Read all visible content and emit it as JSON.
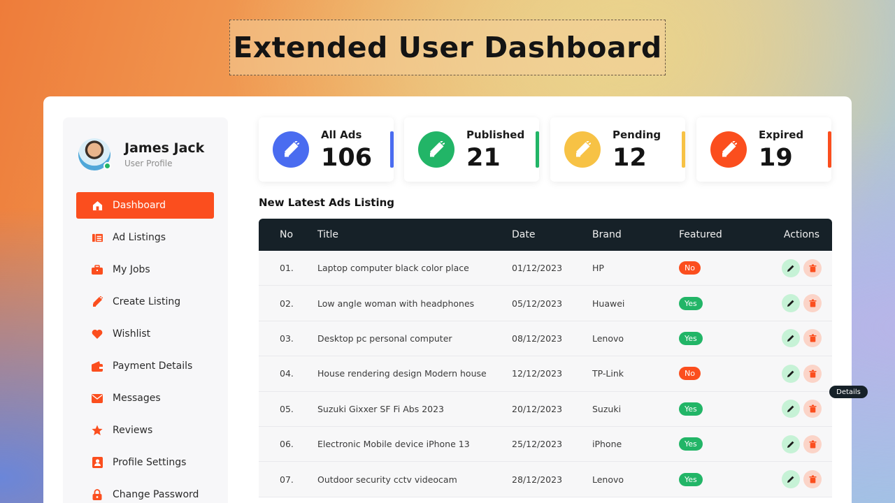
{
  "banner": {
    "title": "Extended User Dashboard"
  },
  "profile": {
    "name": "James Jack",
    "role": "User Profile",
    "status": "online"
  },
  "menu": [
    {
      "label": "Dashboard",
      "icon": "home-icon",
      "active": true
    },
    {
      "label": "Ad Listings",
      "icon": "list-icon",
      "active": false
    },
    {
      "label": "My Jobs",
      "icon": "briefcase-icon",
      "active": false
    },
    {
      "label": "Create Listing",
      "icon": "megaphone-icon",
      "active": false
    },
    {
      "label": "Wishlist",
      "icon": "heart-icon",
      "active": false
    },
    {
      "label": "Payment Details",
      "icon": "wallet-icon",
      "active": false
    },
    {
      "label": "Messages",
      "icon": "envelope-icon",
      "active": false
    },
    {
      "label": "Reviews",
      "icon": "star-icon",
      "active": false
    },
    {
      "label": "Profile Settings",
      "icon": "user-settings-icon",
      "active": false
    },
    {
      "label": "Change Password",
      "icon": "lock-icon",
      "active": false
    }
  ],
  "stats": [
    {
      "label": "All Ads",
      "value": "106",
      "color": "#4a6cf0"
    },
    {
      "label": "Published",
      "value": "21",
      "color": "#22b567"
    },
    {
      "label": "Pending",
      "value": "12",
      "color": "#f7c245"
    },
    {
      "label": "Expired",
      "value": "19",
      "color": "#fb4e1e"
    }
  ],
  "listing": {
    "title": "New Latest Ads Listing",
    "columns": [
      "No",
      "Title",
      "Date",
      "Brand",
      "Featured",
      "Actions"
    ],
    "rows": [
      {
        "no": "01.",
        "title": "Laptop computer black color place",
        "date": "01/12/2023",
        "brand": "HP",
        "featured": "No"
      },
      {
        "no": "02.",
        "title": "Low angle woman with headphones",
        "date": "05/12/2023",
        "brand": "Huawei",
        "featured": "Yes"
      },
      {
        "no": "03.",
        "title": "Desktop pc personal computer",
        "date": "08/12/2023",
        "brand": "Lenovo",
        "featured": "Yes"
      },
      {
        "no": "04.",
        "title": "House rendering design Modern house",
        "date": "12/12/2023",
        "brand": "TP-Link",
        "featured": "No"
      },
      {
        "no": "05.",
        "title": "Suzuki Gixxer SF Fi Abs 2023",
        "date": "20/12/2023",
        "brand": "Suzuki",
        "featured": "Yes"
      },
      {
        "no": "06.",
        "title": "Electronic Mobile device iPhone 13",
        "date": "25/12/2023",
        "brand": "iPhone",
        "featured": "Yes"
      },
      {
        "no": "07.",
        "title": "Outdoor security cctv videocam",
        "date": "28/12/2023",
        "brand": "Lenovo",
        "featured": "Yes"
      }
    ]
  },
  "tooltip": {
    "text": "Details"
  },
  "colors": {
    "accent": "#fb4e1e",
    "header": "#162128",
    "yes": "#22b567",
    "no": "#fb4e1e"
  }
}
